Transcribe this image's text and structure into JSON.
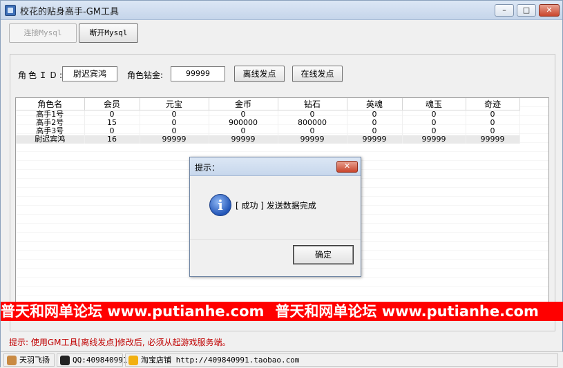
{
  "window": {
    "title": "校花的贴身高手-GM工具",
    "min_label": "–",
    "max_label": "□",
    "close_label": "✕"
  },
  "toolbar": {
    "connect_label": "连接Mysql",
    "disconnect_label": "断开Mysql"
  },
  "form": {
    "role_id_label": "角色ＩＤ:",
    "role_id_value": "尉迟宾鸿",
    "diamond_label": "角色钻金:",
    "diamond_value": "99999",
    "offline_button": "离线发点",
    "online_button": "在线发点"
  },
  "grid": {
    "columns": [
      "角色名",
      "会员",
      "元宝",
      "金币",
      "钻石",
      "英魂",
      "魂玉",
      "奇迹"
    ],
    "rows": [
      [
        "高手1号",
        "0",
        "0",
        "0",
        "0",
        "0",
        "0",
        "0"
      ],
      [
        "高手2号",
        "15",
        "0",
        "900000",
        "800000",
        "0",
        "0",
        "0"
      ],
      [
        "高手3号",
        "0",
        "0",
        "0",
        "0",
        "0",
        "0",
        "0"
      ],
      [
        "尉迟宾鸿",
        "16",
        "99999",
        "99999",
        "99999",
        "99999",
        "99999",
        "99999"
      ]
    ],
    "selected_row": 3
  },
  "banner": {
    "text_1": "普天和网单论坛 www.putianhe.com",
    "text_2": "普天和网单论坛 www.putianhe.com"
  },
  "hint": "提示: 使用GM工具[离线发点]修改后, 必须从起游戏服务端。",
  "statusbar": {
    "author": "天羽飞扬",
    "qq": "QQ:409840991",
    "shop": "淘宝店铺 http://409840991.taobao.com"
  },
  "dialog": {
    "title": "提示：",
    "close_label": "✕",
    "message": "[ 成功 ] 发送数据完成",
    "ok_label": "确定",
    "icon": "info-icon"
  },
  "colors": {
    "banner": "#ff0000",
    "hint_text": "#c00000"
  }
}
